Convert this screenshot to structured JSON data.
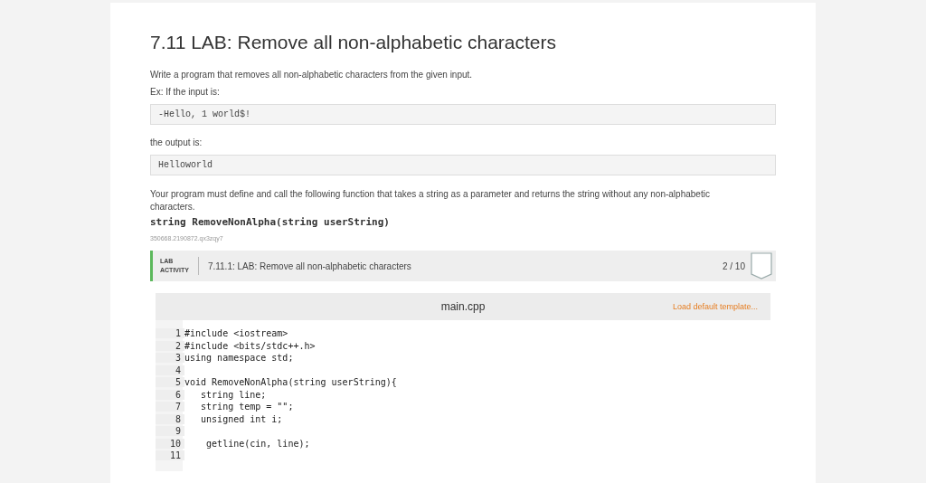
{
  "title": "7.11 LAB: Remove all non-alphabetic characters",
  "intro": "Write a program that removes all non-alphabetic characters from the given input.",
  "example_label": "Ex: If the input is:",
  "example_input": "-Hello, 1 world$!",
  "output_label": "the output is:",
  "example_output": "Helloworld",
  "description": "Your program must define and call the following function that takes a string as a parameter and returns the string without any non-alphabetic characters.",
  "signature": "string RemoveNonAlpha(string userString)",
  "content_id": "350668.2190872.qx3zqy7",
  "lab": {
    "tag_line_1": "LAB",
    "tag_line_2": "ACTIVITY",
    "name": "7.11.1: LAB: Remove all non-alphabetic characters",
    "score": "2 / 10"
  },
  "editor": {
    "filename": "main.cpp",
    "template_link": "Load default template...",
    "lines": [
      {
        "number": "1",
        "code": "#include <iostream>"
      },
      {
        "number": "2",
        "code": "#include <bits/stdc++.h>"
      },
      {
        "number": "3",
        "code": "using namespace std;"
      },
      {
        "number": "4"
      },
      {
        "number": "5",
        "code": "void RemoveNonAlpha(string userString){"
      },
      {
        "number": "6",
        "code": "   string line;"
      },
      {
        "number": "7",
        "code": "   string temp = \"\";"
      },
      {
        "number": "8",
        "code": "   unsigned int i;"
      },
      {
        "number": "9"
      },
      {
        "number": "10",
        "code": "    getline(cin, line);"
      },
      {
        "number": "11"
      }
    ]
  }
}
